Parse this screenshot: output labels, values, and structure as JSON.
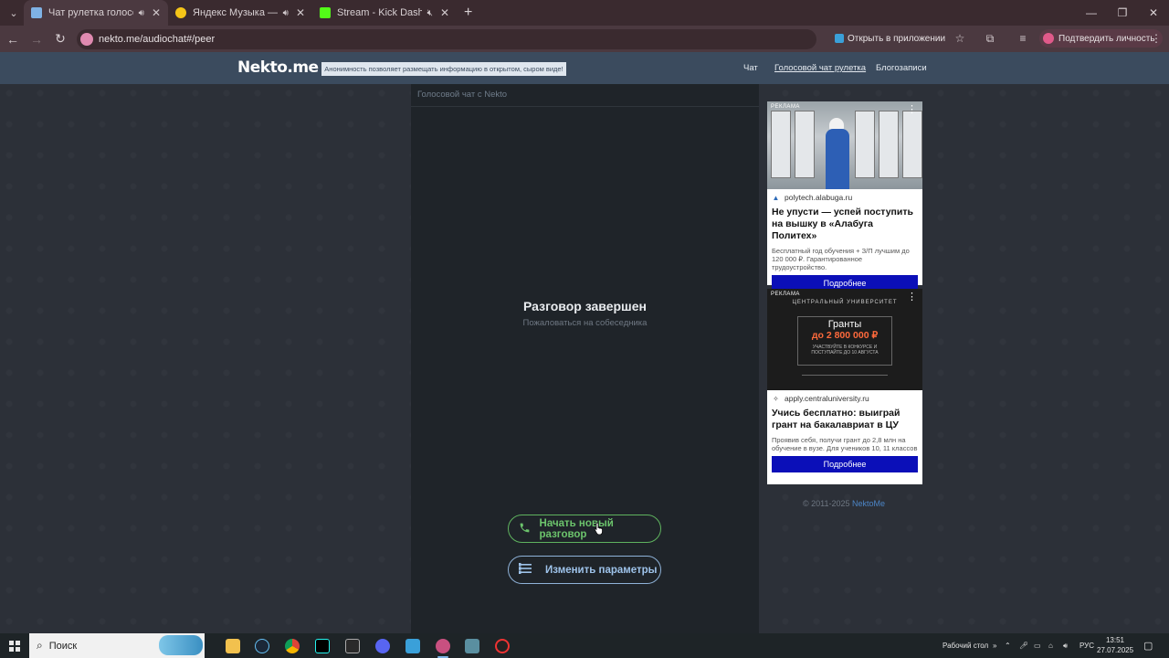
{
  "browser": {
    "tabs": [
      {
        "title": "Чат рулетка голосовая — ",
        "active": true,
        "favicon_color": "#7fb2e5",
        "has_sound_icon": true
      },
      {
        "title": "Яндекс Музыка — собирае",
        "active": false,
        "favicon_color": "#f5c518",
        "has_sound_icon": true
      },
      {
        "title": "Stream - Kick Dashboard",
        "active": false,
        "favicon_color": "#53fc18",
        "has_sound_icon": true
      }
    ],
    "new_tab_symbol": "+",
    "url": "nekto.me/audiochat#/peer",
    "open_in_app_label": "Открыть в приложении",
    "verify_identity_label": "Подтвердить личность"
  },
  "site": {
    "logo": "Nekto.me",
    "tagline": "Анонимность позволяет размещать информацию в открытом, сыром виде!",
    "nav": [
      {
        "label": "Чат",
        "current": false
      },
      {
        "label": "Голосовой чат рулетка",
        "current": true
      },
      {
        "label": "Блогозаписи",
        "current": false
      }
    ]
  },
  "chat": {
    "header": "Голосовой чат с Nekto",
    "status_title": "Разговор завершен",
    "complain_link": "Пожаловаться на собеседника",
    "start_button": "Начать новый разговор",
    "params_button": "Изменить параметры"
  },
  "ads": [
    {
      "label": "РЕКЛАМА",
      "domain": "polytech.alabuga.ru",
      "title": "Не упусти — успей поступить на вышку в «Алабуга Политех»",
      "desc": "Бесплатный год обучения + З/П лучшим до 120 000 ₽. Гарантированное трудоустройство.",
      "button": "Подробнее"
    },
    {
      "label": "РЕКЛАМА",
      "image_logo": "ЦЕНТРАЛЬНЫЙ УНИВЕРСИТЕТ",
      "image_line1": "Гранты",
      "image_line2": "до 2 800 000 ₽",
      "image_line3": "УЧАСТВУЙТЕ В КОНКУРСЕ И ПОСТУПАЙТЕ ДО 10 АВГУСТА",
      "domain": "apply.centraluniversity.ru",
      "title": "Учись бесплатно: выиграй грант на бакалавриат в ЦУ",
      "desc": "Проявив себя, получи грант до 2,8 млн на обучение в вузе. Для учеников 10, 11 классов",
      "button": "Подробнее"
    }
  ],
  "footer": {
    "copyright": "© 2011-2025",
    "brand_link": "NektoMe"
  },
  "taskbar": {
    "search_placeholder": "Поиск",
    "desktop_label": "Рабочий стол",
    "language": "РУС",
    "time": "13:51",
    "date": "27.07.2025"
  },
  "colors": {
    "header_bg": "#3b4b5e",
    "panel_bg": "#1f2429",
    "start_green": "#6cc46c",
    "params_blue": "#9ec3ea",
    "ad_button": "#0b0fb8"
  }
}
